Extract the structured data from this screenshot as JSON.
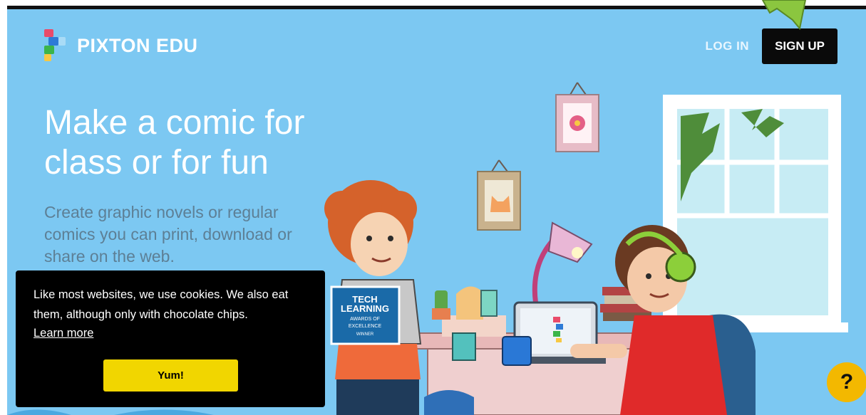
{
  "header": {
    "logo_text": "PIXTON EDU",
    "login_label": "LOG IN",
    "signup_label": "SIGN UP"
  },
  "hero": {
    "headline": "Make a comic for class or for fun",
    "subtext": "Create graphic novels or regular comics you can print, download or share on the web.",
    "badge_lines": [
      "TECH",
      "LEARNING",
      "AWARDS OF",
      "EXCELLENCE",
      "WINNER"
    ]
  },
  "cookie_banner": {
    "message": "Like most websites, we use cookies. We also eat them, although only with chocolate chips.",
    "learn_more": "Learn more",
    "accept_label": "Yum!"
  },
  "help_button": {
    "label": "?"
  },
  "colors": {
    "hero_background": "#7cc8f2",
    "signup_button": "#0a0a0a",
    "accept_button": "#f1d600",
    "help_button": "#f3b800",
    "annotation_arrow": "#8bc63f"
  }
}
